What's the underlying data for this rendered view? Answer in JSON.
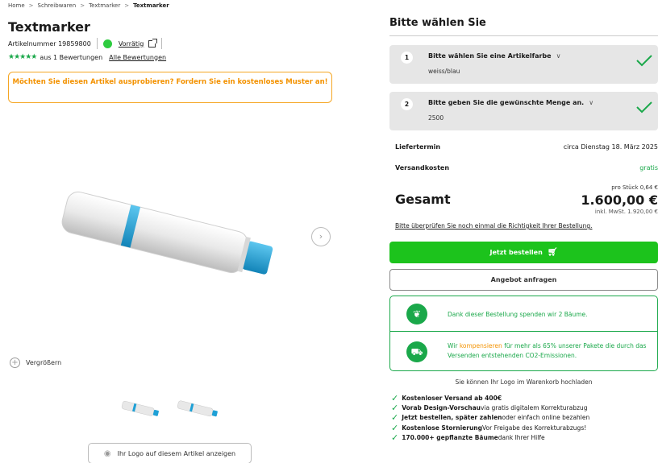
{
  "breadcrumb": {
    "items": [
      "Home",
      "Schreibwaren",
      "Textmarker"
    ],
    "current": "Textmarker",
    "sep": ">"
  },
  "product": {
    "title": "Textmarker",
    "article_label": "Artikelnummer 19859800",
    "availability": "Vorrätig",
    "stars": "★★★★★",
    "reviews_text": "aus 1 Bewertungen",
    "all_reviews_link": "Alle Bewertungen",
    "sample_text": "Möchten Sie diesen Artikel ausprobieren? Fordern Sie ein kostenloses Muster an!",
    "zoom_label": "Vergrößern",
    "logo_button": "Ihr Logo auf diesem Artikel anzeigen"
  },
  "config": {
    "title": "Bitte wählen Sie",
    "steps": [
      {
        "num": "1",
        "label": "Bitte wählen Sie eine Artikelfarbe",
        "value": "weiss/blau"
      },
      {
        "num": "2",
        "label": "Bitte geben Sie die gewünschte Menge an.",
        "value": "2500"
      }
    ],
    "delivery_label": "Liefertermin",
    "delivery_value": "circa Dienstag 18. März 2025",
    "shipping_label": "Versandkosten",
    "shipping_value": "gratis",
    "unit_price": "pro Stück 0,64 €",
    "total_label": "Gesamt",
    "total_value": "1.600,00 €",
    "vat_note": "inkl. MwSt. 1.920,00 €",
    "check_note": "Bitte überprüfen Sie noch einmal die Richtigkeit Ihrer Bestellung.",
    "order_button": "Jetzt bestellen",
    "offer_button": "Angebot anfragen"
  },
  "eco": {
    "trees_text": "Dank dieser Bestellung spenden wir 2 Bäume.",
    "co2_pre": "Wir ",
    "co2_highlight": "kompensieren",
    "co2_post": " für mehr als 65% unserer Pakete die durch das Versenden entstehenden CO2-Emissionen."
  },
  "upload_note": "Sie können Ihr Logo im Warenkorb hochladen",
  "benefits": [
    {
      "bold": "Kostenloser Versand ab 400€",
      "rest": ""
    },
    {
      "bold": "Vorab Design-Vorschau",
      "rest": " via gratis digitalem Korrekturabzug"
    },
    {
      "bold": "Jetzt bestellen, später zahlen",
      "rest": " oder einfach online bezahlen"
    },
    {
      "bold": "Kostenlose Stornierung",
      "rest": " Vor Freigabe des Korrekturabzugs!"
    },
    {
      "bold": "170.000+ gepflanzte Bäume",
      "rest": " dank Ihrer Hilfe"
    }
  ],
  "colors": {
    "green": "#1cc31c",
    "orange": "#f39200",
    "accent_blue": "#1ea0d6"
  }
}
